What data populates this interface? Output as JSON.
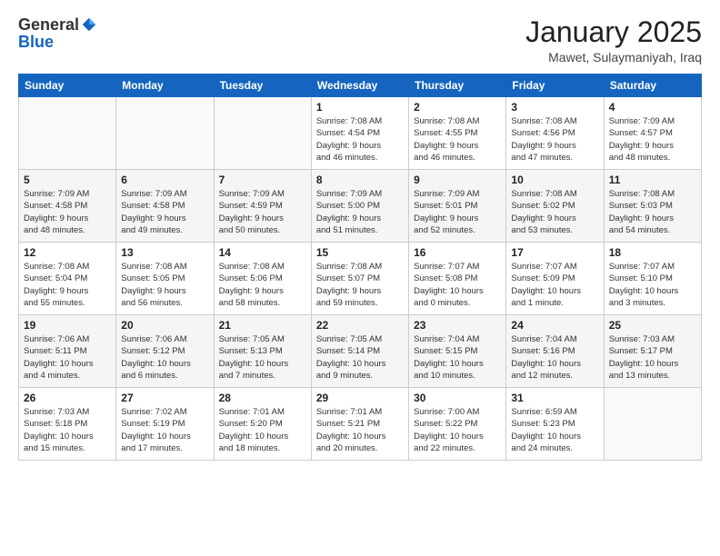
{
  "header": {
    "logo_general": "General",
    "logo_blue": "Blue",
    "month_title": "January 2025",
    "location": "Mawet, Sulaymaniyah, Iraq"
  },
  "days_of_week": [
    "Sunday",
    "Monday",
    "Tuesday",
    "Wednesday",
    "Thursday",
    "Friday",
    "Saturday"
  ],
  "weeks": [
    [
      {
        "day": "",
        "info": ""
      },
      {
        "day": "",
        "info": ""
      },
      {
        "day": "",
        "info": ""
      },
      {
        "day": "1",
        "info": "Sunrise: 7:08 AM\nSunset: 4:54 PM\nDaylight: 9 hours\nand 46 minutes."
      },
      {
        "day": "2",
        "info": "Sunrise: 7:08 AM\nSunset: 4:55 PM\nDaylight: 9 hours\nand 46 minutes."
      },
      {
        "day": "3",
        "info": "Sunrise: 7:08 AM\nSunset: 4:56 PM\nDaylight: 9 hours\nand 47 minutes."
      },
      {
        "day": "4",
        "info": "Sunrise: 7:09 AM\nSunset: 4:57 PM\nDaylight: 9 hours\nand 48 minutes."
      }
    ],
    [
      {
        "day": "5",
        "info": "Sunrise: 7:09 AM\nSunset: 4:58 PM\nDaylight: 9 hours\nand 48 minutes."
      },
      {
        "day": "6",
        "info": "Sunrise: 7:09 AM\nSunset: 4:58 PM\nDaylight: 9 hours\nand 49 minutes."
      },
      {
        "day": "7",
        "info": "Sunrise: 7:09 AM\nSunset: 4:59 PM\nDaylight: 9 hours\nand 50 minutes."
      },
      {
        "day": "8",
        "info": "Sunrise: 7:09 AM\nSunset: 5:00 PM\nDaylight: 9 hours\nand 51 minutes."
      },
      {
        "day": "9",
        "info": "Sunrise: 7:09 AM\nSunset: 5:01 PM\nDaylight: 9 hours\nand 52 minutes."
      },
      {
        "day": "10",
        "info": "Sunrise: 7:08 AM\nSunset: 5:02 PM\nDaylight: 9 hours\nand 53 minutes."
      },
      {
        "day": "11",
        "info": "Sunrise: 7:08 AM\nSunset: 5:03 PM\nDaylight: 9 hours\nand 54 minutes."
      }
    ],
    [
      {
        "day": "12",
        "info": "Sunrise: 7:08 AM\nSunset: 5:04 PM\nDaylight: 9 hours\nand 55 minutes."
      },
      {
        "day": "13",
        "info": "Sunrise: 7:08 AM\nSunset: 5:05 PM\nDaylight: 9 hours\nand 56 minutes."
      },
      {
        "day": "14",
        "info": "Sunrise: 7:08 AM\nSunset: 5:06 PM\nDaylight: 9 hours\nand 58 minutes."
      },
      {
        "day": "15",
        "info": "Sunrise: 7:08 AM\nSunset: 5:07 PM\nDaylight: 9 hours\nand 59 minutes."
      },
      {
        "day": "16",
        "info": "Sunrise: 7:07 AM\nSunset: 5:08 PM\nDaylight: 10 hours\nand 0 minutes."
      },
      {
        "day": "17",
        "info": "Sunrise: 7:07 AM\nSunset: 5:09 PM\nDaylight: 10 hours\nand 1 minute."
      },
      {
        "day": "18",
        "info": "Sunrise: 7:07 AM\nSunset: 5:10 PM\nDaylight: 10 hours\nand 3 minutes."
      }
    ],
    [
      {
        "day": "19",
        "info": "Sunrise: 7:06 AM\nSunset: 5:11 PM\nDaylight: 10 hours\nand 4 minutes."
      },
      {
        "day": "20",
        "info": "Sunrise: 7:06 AM\nSunset: 5:12 PM\nDaylight: 10 hours\nand 6 minutes."
      },
      {
        "day": "21",
        "info": "Sunrise: 7:05 AM\nSunset: 5:13 PM\nDaylight: 10 hours\nand 7 minutes."
      },
      {
        "day": "22",
        "info": "Sunrise: 7:05 AM\nSunset: 5:14 PM\nDaylight: 10 hours\nand 9 minutes."
      },
      {
        "day": "23",
        "info": "Sunrise: 7:04 AM\nSunset: 5:15 PM\nDaylight: 10 hours\nand 10 minutes."
      },
      {
        "day": "24",
        "info": "Sunrise: 7:04 AM\nSunset: 5:16 PM\nDaylight: 10 hours\nand 12 minutes."
      },
      {
        "day": "25",
        "info": "Sunrise: 7:03 AM\nSunset: 5:17 PM\nDaylight: 10 hours\nand 13 minutes."
      }
    ],
    [
      {
        "day": "26",
        "info": "Sunrise: 7:03 AM\nSunset: 5:18 PM\nDaylight: 10 hours\nand 15 minutes."
      },
      {
        "day": "27",
        "info": "Sunrise: 7:02 AM\nSunset: 5:19 PM\nDaylight: 10 hours\nand 17 minutes."
      },
      {
        "day": "28",
        "info": "Sunrise: 7:01 AM\nSunset: 5:20 PM\nDaylight: 10 hours\nand 18 minutes."
      },
      {
        "day": "29",
        "info": "Sunrise: 7:01 AM\nSunset: 5:21 PM\nDaylight: 10 hours\nand 20 minutes."
      },
      {
        "day": "30",
        "info": "Sunrise: 7:00 AM\nSunset: 5:22 PM\nDaylight: 10 hours\nand 22 minutes."
      },
      {
        "day": "31",
        "info": "Sunrise: 6:59 AM\nSunset: 5:23 PM\nDaylight: 10 hours\nand 24 minutes."
      },
      {
        "day": "",
        "info": ""
      }
    ]
  ]
}
